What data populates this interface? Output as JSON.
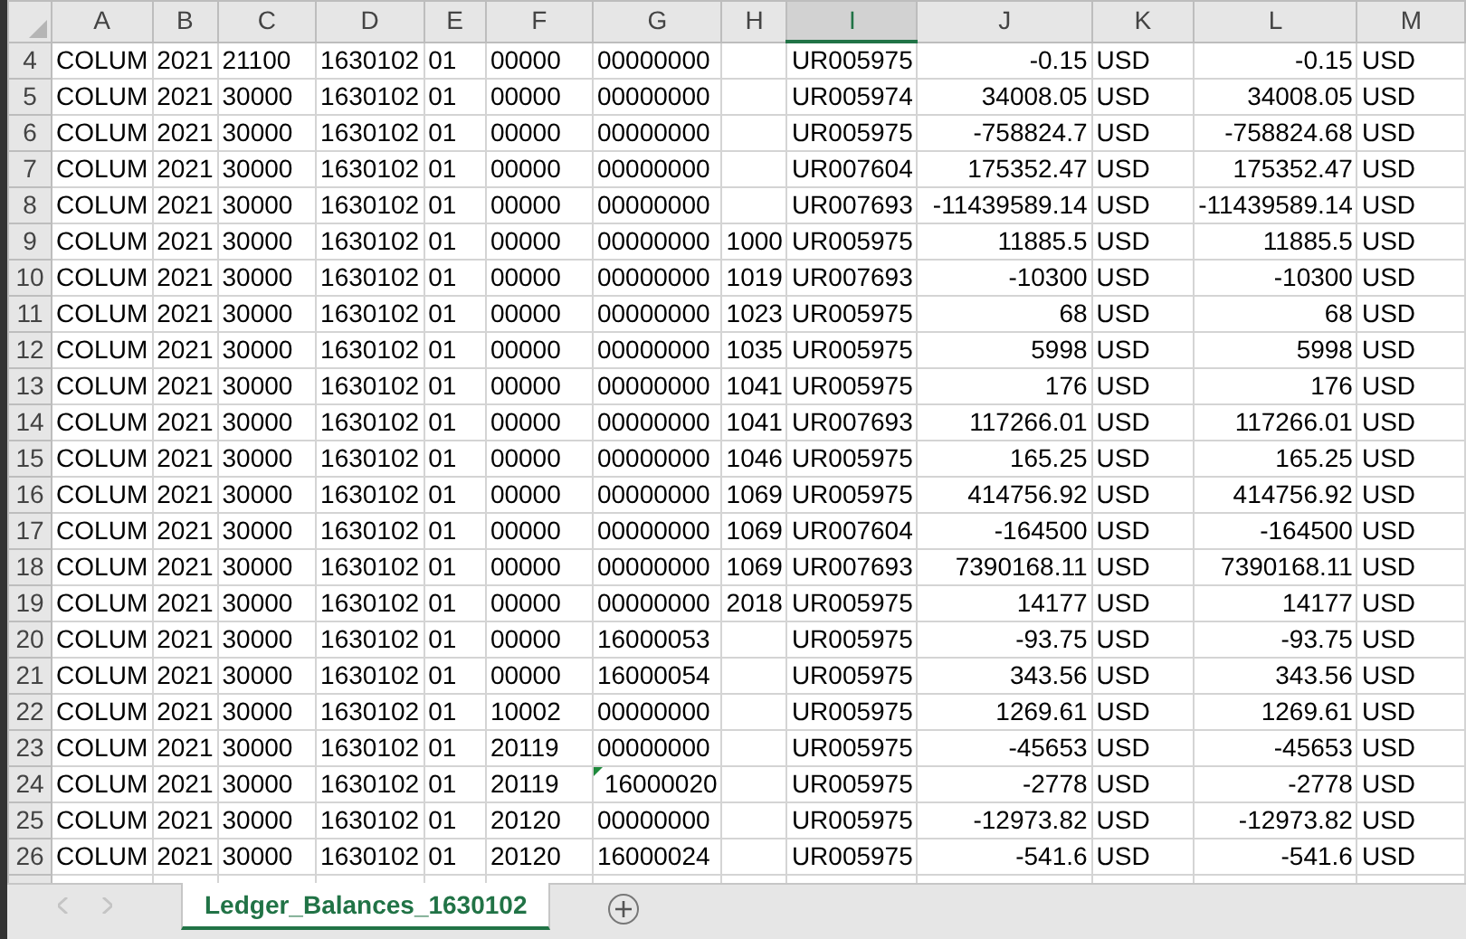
{
  "columns": [
    {
      "letter": "A",
      "kind": "text",
      "selected": false
    },
    {
      "letter": "B",
      "kind": "text",
      "selected": false
    },
    {
      "letter": "C",
      "kind": "text",
      "selected": false
    },
    {
      "letter": "D",
      "kind": "text",
      "selected": false
    },
    {
      "letter": "E",
      "kind": "text",
      "selected": false
    },
    {
      "letter": "F",
      "kind": "text",
      "selected": false
    },
    {
      "letter": "G",
      "kind": "text",
      "selected": false
    },
    {
      "letter": "H",
      "kind": "text",
      "selected": false
    },
    {
      "letter": "I",
      "kind": "text",
      "selected": true
    },
    {
      "letter": "J",
      "kind": "number",
      "selected": false
    },
    {
      "letter": "K",
      "kind": "text",
      "selected": false
    },
    {
      "letter": "L",
      "kind": "number",
      "selected": false
    },
    {
      "letter": "M",
      "kind": "text",
      "selected": false
    }
  ],
  "rows": [
    {
      "number": "4",
      "cells": [
        "COLUM",
        "2021",
        "21100",
        "1630102",
        "01",
        "00000",
        "00000000",
        "",
        "UR005975",
        "-0.15",
        "USD",
        "-0.15",
        "USD"
      ]
    },
    {
      "number": "5",
      "cells": [
        "COLUM",
        "2021",
        "30000",
        "1630102",
        "01",
        "00000",
        "00000000",
        "",
        "UR005974",
        "34008.05",
        "USD",
        "34008.05",
        "USD"
      ]
    },
    {
      "number": "6",
      "cells": [
        "COLUM",
        "2021",
        "30000",
        "1630102",
        "01",
        "00000",
        "00000000",
        "",
        "UR005975",
        "-758824.7",
        "USD",
        "-758824.68",
        "USD"
      ]
    },
    {
      "number": "7",
      "cells": [
        "COLUM",
        "2021",
        "30000",
        "1630102",
        "01",
        "00000",
        "00000000",
        "",
        "UR007604",
        "175352.47",
        "USD",
        "175352.47",
        "USD"
      ]
    },
    {
      "number": "8",
      "cells": [
        "COLUM",
        "2021",
        "30000",
        "1630102",
        "01",
        "00000",
        "00000000",
        "",
        "UR007693",
        "-11439589.14",
        "USD",
        "-11439589.14",
        "USD"
      ]
    },
    {
      "number": "9",
      "cells": [
        "COLUM",
        "2021",
        "30000",
        "1630102",
        "01",
        "00000",
        "00000000",
        "1000",
        "UR005975",
        "11885.5",
        "USD",
        "11885.5",
        "USD"
      ]
    },
    {
      "number": "10",
      "cells": [
        "COLUM",
        "2021",
        "30000",
        "1630102",
        "01",
        "00000",
        "00000000",
        "1019",
        "UR007693",
        "-10300",
        "USD",
        "-10300",
        "USD"
      ]
    },
    {
      "number": "11",
      "cells": [
        "COLUM",
        "2021",
        "30000",
        "1630102",
        "01",
        "00000",
        "00000000",
        "1023",
        "UR005975",
        "68",
        "USD",
        "68",
        "USD"
      ]
    },
    {
      "number": "12",
      "cells": [
        "COLUM",
        "2021",
        "30000",
        "1630102",
        "01",
        "00000",
        "00000000",
        "1035",
        "UR005975",
        "5998",
        "USD",
        "5998",
        "USD"
      ]
    },
    {
      "number": "13",
      "cells": [
        "COLUM",
        "2021",
        "30000",
        "1630102",
        "01",
        "00000",
        "00000000",
        "1041",
        "UR005975",
        "176",
        "USD",
        "176",
        "USD"
      ]
    },
    {
      "number": "14",
      "cells": [
        "COLUM",
        "2021",
        "30000",
        "1630102",
        "01",
        "00000",
        "00000000",
        "1041",
        "UR007693",
        "117266.01",
        "USD",
        "117266.01",
        "USD"
      ]
    },
    {
      "number": "15",
      "cells": [
        "COLUM",
        "2021",
        "30000",
        "1630102",
        "01",
        "00000",
        "00000000",
        "1046",
        "UR005975",
        "165.25",
        "USD",
        "165.25",
        "USD"
      ]
    },
    {
      "number": "16",
      "cells": [
        "COLUM",
        "2021",
        "30000",
        "1630102",
        "01",
        "00000",
        "00000000",
        "1069",
        "UR005975",
        "414756.92",
        "USD",
        "414756.92",
        "USD"
      ]
    },
    {
      "number": "17",
      "cells": [
        "COLUM",
        "2021",
        "30000",
        "1630102",
        "01",
        "00000",
        "00000000",
        "1069",
        "UR007604",
        "-164500",
        "USD",
        "-164500",
        "USD"
      ]
    },
    {
      "number": "18",
      "cells": [
        "COLUM",
        "2021",
        "30000",
        "1630102",
        "01",
        "00000",
        "00000000",
        "1069",
        "UR007693",
        "7390168.11",
        "USD",
        "7390168.11",
        "USD"
      ]
    },
    {
      "number": "19",
      "cells": [
        "COLUM",
        "2021",
        "30000",
        "1630102",
        "01",
        "00000",
        "00000000",
        "2018",
        "UR005975",
        "14177",
        "USD",
        "14177",
        "USD"
      ]
    },
    {
      "number": "20",
      "cells": [
        "COLUM",
        "2021",
        "30000",
        "1630102",
        "01",
        "00000",
        "16000053",
        "",
        "UR005975",
        "-93.75",
        "USD",
        "-93.75",
        "USD"
      ]
    },
    {
      "number": "21",
      "cells": [
        "COLUM",
        "2021",
        "30000",
        "1630102",
        "01",
        "00000",
        "16000054",
        "",
        "UR005975",
        "343.56",
        "USD",
        "343.56",
        "USD"
      ]
    },
    {
      "number": "22",
      "cells": [
        "COLUM",
        "2021",
        "30000",
        "1630102",
        "01",
        "10002",
        "00000000",
        "",
        "UR005975",
        "1269.61",
        "USD",
        "1269.61",
        "USD"
      ]
    },
    {
      "number": "23",
      "cells": [
        "COLUM",
        "2021",
        "30000",
        "1630102",
        "01",
        "20119",
        "00000000",
        "",
        "UR005975",
        "-45653",
        "USD",
        "-45653",
        "USD"
      ]
    },
    {
      "number": "24",
      "cells": [
        "COLUM",
        "2021",
        "30000",
        "1630102",
        "01",
        "20119",
        {
          "text": "16000020",
          "warning": true
        },
        "",
        "UR005975",
        "-2778",
        "USD",
        "-2778",
        "USD"
      ]
    },
    {
      "number": "25",
      "cells": [
        "COLUM",
        "2021",
        "30000",
        "1630102",
        "01",
        "20120",
        "00000000",
        "",
        "UR005975",
        "-12973.82",
        "USD",
        "-12973.82",
        "USD"
      ]
    },
    {
      "number": "26",
      "cells": [
        "COLUM",
        "2021",
        "30000",
        "1630102",
        "01",
        "20120",
        "16000024",
        "",
        "UR005975",
        "-541.6",
        "USD",
        "-541.6",
        "USD"
      ]
    }
  ],
  "sheet_tabs": [
    {
      "label": "Ledger_Balances_1630102",
      "selected": true
    }
  ]
}
